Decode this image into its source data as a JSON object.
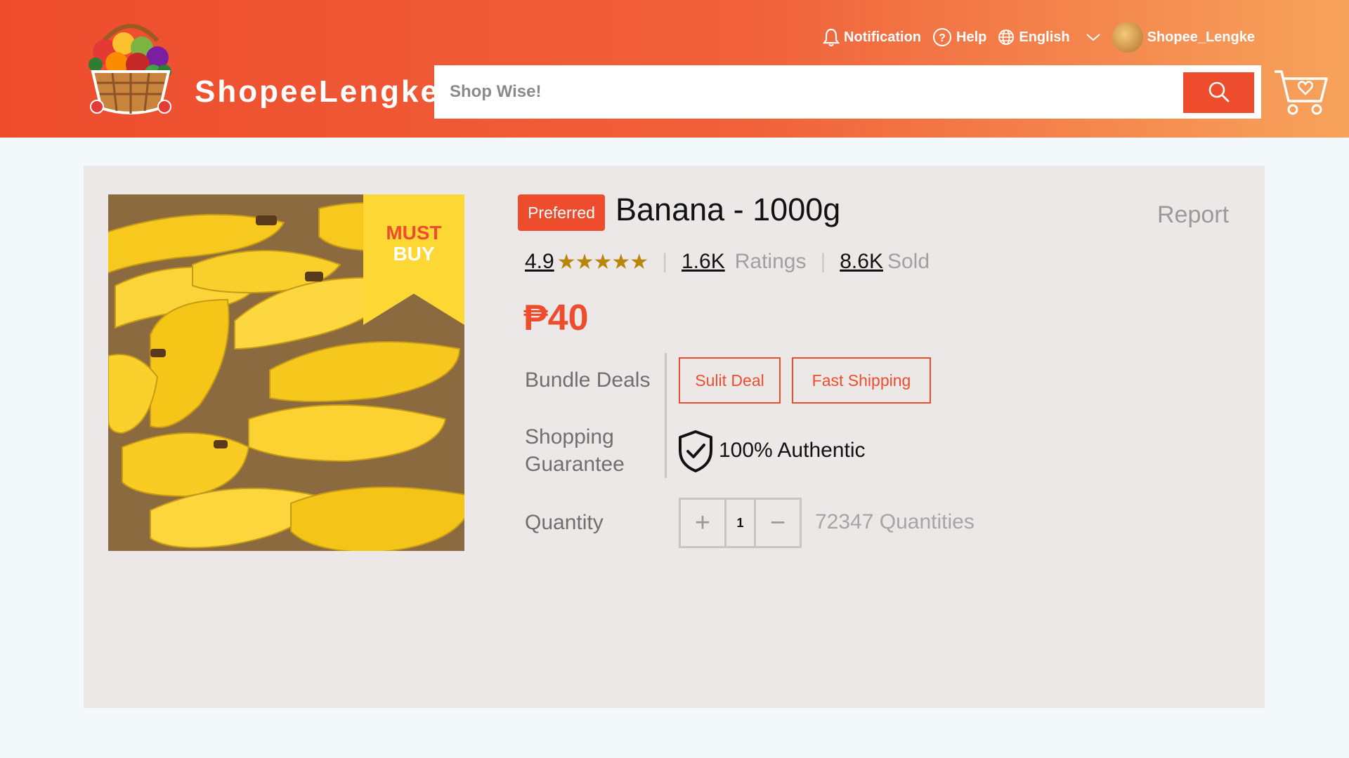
{
  "header": {
    "brand": "ShopeeLengke",
    "nav": {
      "notification": "Notification",
      "help": "Help",
      "language": "English",
      "username": "Shopee_Lengke"
    },
    "search": {
      "placeholder": "Shop Wise!"
    }
  },
  "product": {
    "badge": "Preferred",
    "title": "Banana - 1000g",
    "report": "Report",
    "rating": "4.9",
    "stars": "★★★★★",
    "ratings_count": "1.6K",
    "ratings_label": "Ratings",
    "sold_count": "8.6K",
    "sold_label": "Sold",
    "price": "₱40",
    "image_tag": {
      "line1": "MUST",
      "line2": "BUY"
    }
  },
  "details": {
    "bundle_label": "Bundle Deals",
    "bundle_deals": [
      "Sulit Deal",
      "Fast Shipping"
    ],
    "guarantee_label_1": "Shopping",
    "guarantee_label_2": "Guarantee",
    "guarantee_text": "100% Authentic",
    "quantity_label": "Quantity",
    "quantity_value": "1",
    "quantity_available": "72347 Quantities",
    "plus": "+",
    "minus": "−"
  },
  "colors": {
    "brand": "#ee4d2d",
    "header_gradient_end": "#f7a35c",
    "star": "#b8860b",
    "banner": "#fdd835"
  },
  "icons": [
    "bell-icon",
    "help-icon",
    "globe-icon",
    "chevron-down-icon",
    "search-icon",
    "cart-icon",
    "shield-check-icon"
  ]
}
